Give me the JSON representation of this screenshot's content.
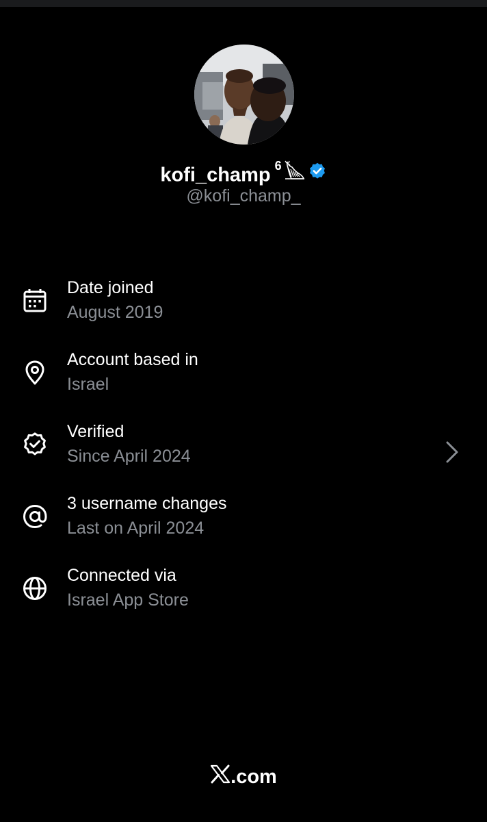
{
  "profile": {
    "display_name": "kofi_champ",
    "superscript": "6",
    "handle": "@kofi_champ_",
    "verified_color": "#1d9bf0"
  },
  "info_items": [
    {
      "icon": "calendar-icon",
      "title": "Date joined",
      "subtitle": "August 2019"
    },
    {
      "icon": "location-pin-icon",
      "title": "Account based in",
      "subtitle": "Israel"
    },
    {
      "icon": "verified-check-icon",
      "title": "Verified",
      "subtitle": "Since April 2024",
      "has_chevron": true
    },
    {
      "icon": "at-sign-icon",
      "title": "3 username changes",
      "subtitle": "Last on April 2024"
    },
    {
      "icon": "globe-icon",
      "title": "Connected via",
      "subtitle": "Israel App Store"
    }
  ],
  "footer": {
    "brand_text": ".com"
  },
  "colors": {
    "background": "#000000",
    "primary_text": "#ffffff",
    "secondary_text": "#8b8f95",
    "accent": "#1d9bf0"
  }
}
